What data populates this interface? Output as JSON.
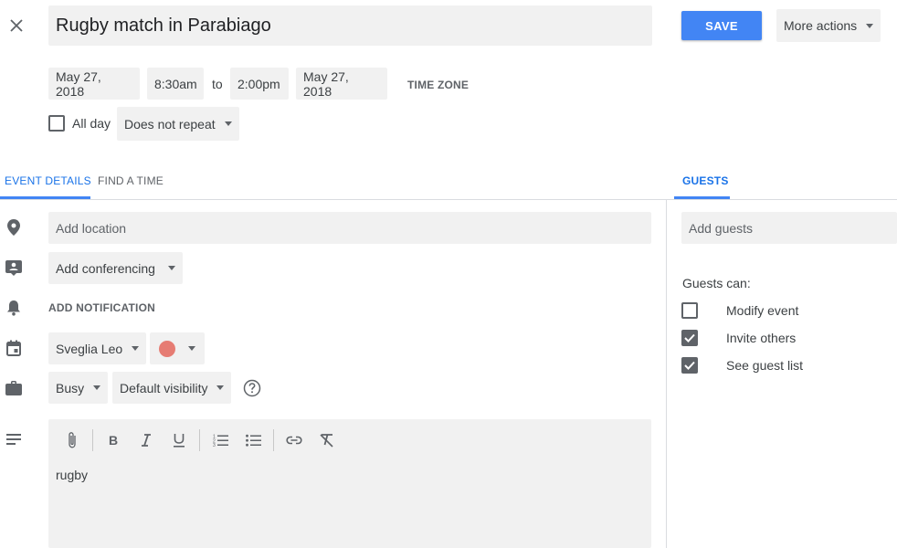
{
  "header": {
    "title_value": "Rugby match in Parabiago",
    "save_label": "SAVE",
    "more_actions_label": "More actions"
  },
  "datetime": {
    "start_date": "May 27, 2018",
    "start_time": "8:30am",
    "to_label": "to",
    "end_time": "2:00pm",
    "end_date": "May 27, 2018",
    "timezone_label": "TIME ZONE",
    "all_day_label": "All day",
    "all_day_checked": false,
    "repeat_value": "Does not repeat"
  },
  "tabs": {
    "event_details": "EVENT DETAILS",
    "find_time": "FIND A TIME",
    "guests": "GUESTS"
  },
  "details": {
    "location_placeholder": "Add location",
    "conferencing_label": "Add conferencing",
    "add_notification_label": "ADD NOTIFICATION",
    "calendar_value": "Sveglia Leo",
    "event_color": "#e67c73",
    "availability_value": "Busy",
    "visibility_value": "Default visibility",
    "description_text": "rugby"
  },
  "guests": {
    "placeholder": "Add guests",
    "guests_can_label": "Guests can:",
    "permissions": [
      {
        "label": "Modify event",
        "checked": false
      },
      {
        "label": "Invite others",
        "checked": true
      },
      {
        "label": "See guest list",
        "checked": true
      }
    ]
  },
  "colors": {
    "accent": "#4285f4",
    "tab_active": "#1a73e8"
  }
}
